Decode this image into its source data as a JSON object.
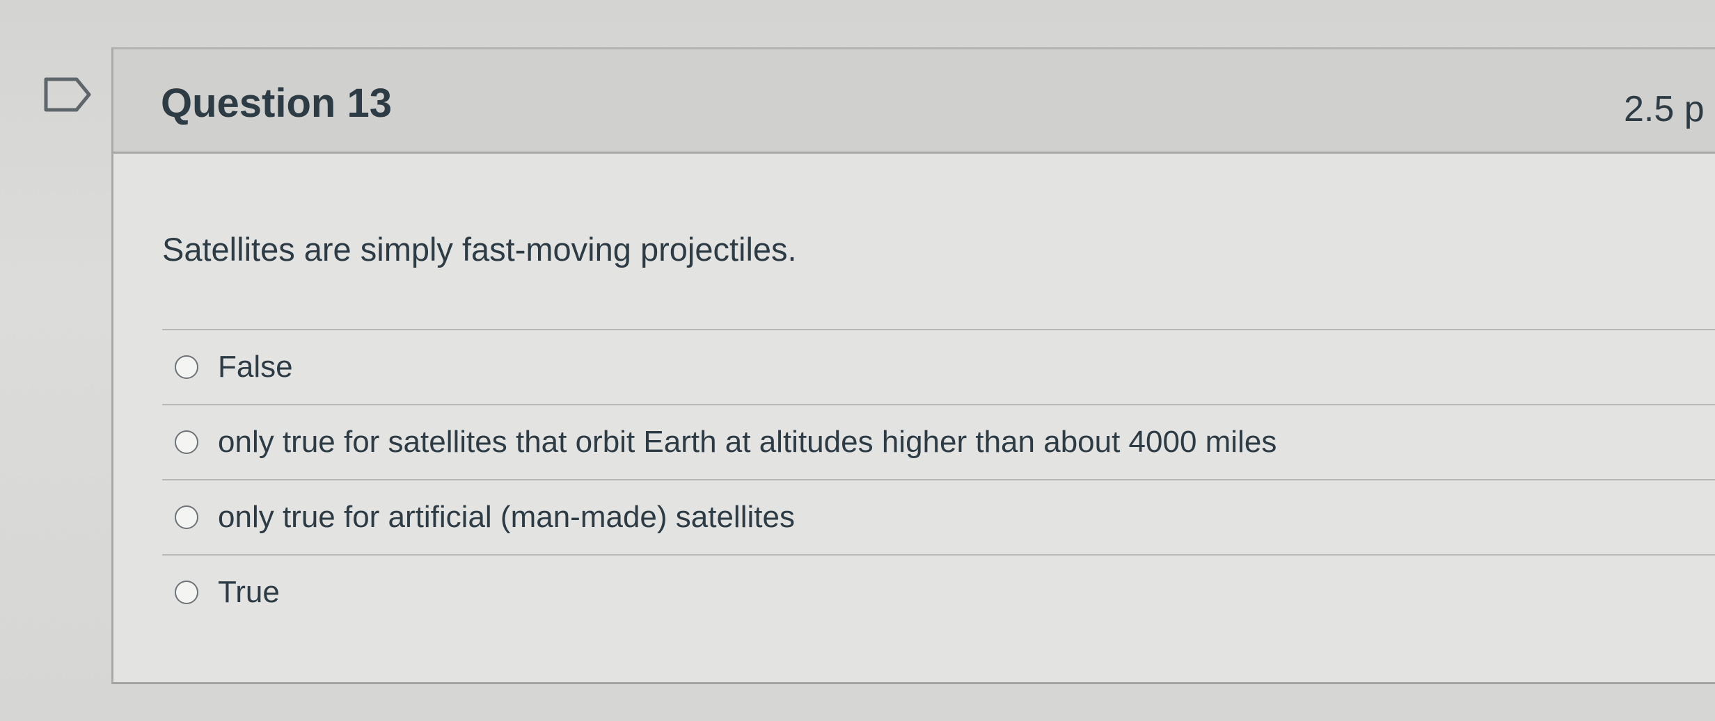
{
  "question": {
    "title": "Question 13",
    "points": "2.5 p",
    "text": "Satellites are simply fast-moving projectiles.",
    "answers": [
      {
        "label": "False"
      },
      {
        "label": "only true for satellites that orbit Earth at altitudes higher than about 4000 miles"
      },
      {
        "label": "only true for artificial (man-made) satellites"
      },
      {
        "label": "True"
      }
    ]
  },
  "icons": {
    "flag": "flag-icon"
  },
  "colors": {
    "text": "#2d3b45",
    "header_bg": "#d0d0ce",
    "border": "#a7a7a5"
  }
}
